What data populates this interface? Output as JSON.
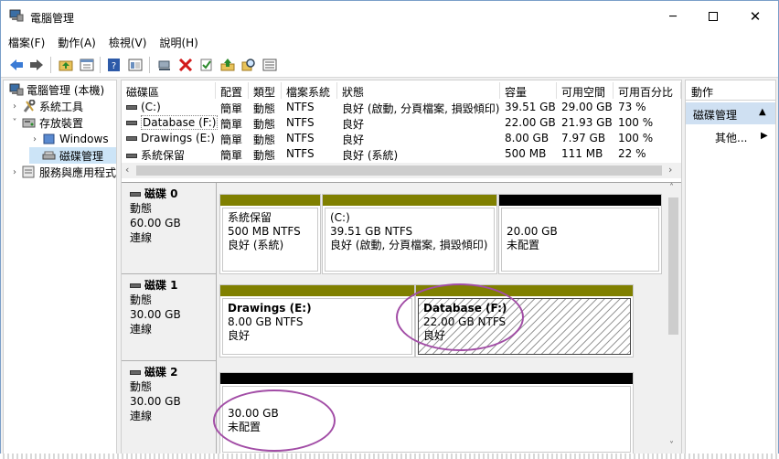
{
  "window": {
    "title": "電腦管理"
  },
  "menu": [
    "檔案(F)",
    "動作(A)",
    "檢視(V)",
    "說明(H)"
  ],
  "toolbar_icons": [
    "back-arrow-icon",
    "forward-arrow-icon",
    "up-folder-icon",
    "properties-icon",
    "help-icon",
    "console-tree-icon",
    "connect-icon",
    "delete-icon",
    "check-icon",
    "export-icon",
    "search-icon",
    "list-icon"
  ],
  "tree": {
    "root": "電腦管理 (本機)",
    "system_tools": "系統工具",
    "storage": "存放裝置",
    "windows": "Windows",
    "disk_mgmt": "磁碟管理",
    "services": "服務與應用程式"
  },
  "volumes": {
    "columns": [
      "磁碟區",
      "配置",
      "類型",
      "檔案系統",
      "狀態",
      "容量",
      "可用空間",
      "可用百分比"
    ],
    "rows": [
      {
        "name": "(C:)",
        "layout": "簡單",
        "type": "動態",
        "fs": "NTFS",
        "status": "良好 (啟動, 分頁檔案, 損毀傾印)",
        "capacity": "39.51 GB",
        "free": "29.00 GB",
        "pct": "73 %"
      },
      {
        "name": "Database (F:)",
        "layout": "簡單",
        "type": "動態",
        "fs": "NTFS",
        "status": "良好",
        "capacity": "22.00 GB",
        "free": "21.93 GB",
        "pct": "100 %"
      },
      {
        "name": "Drawings (E:)",
        "layout": "簡單",
        "type": "動態",
        "fs": "NTFS",
        "status": "良好",
        "capacity": "8.00 GB",
        "free": "7.97 GB",
        "pct": "100 %"
      },
      {
        "name": "系統保留",
        "layout": "簡單",
        "type": "動態",
        "fs": "NTFS",
        "status": "良好 (系統)",
        "capacity": "500 MB",
        "free": "111 MB",
        "pct": "22 %"
      }
    ]
  },
  "disks": [
    {
      "name": "磁碟 0",
      "type": "動態",
      "size": "60.00 GB",
      "state": "連線",
      "partitions": [
        {
          "label": "系統保留",
          "detail": "500 MB NTFS",
          "status": "良好 (系統)",
          "bar": "#808000"
        },
        {
          "label": "(C:)",
          "detail": "39.51 GB NTFS",
          "status": "良好 (啟動, 分頁檔案, 損毀傾印)",
          "bar": "#808000"
        },
        {
          "label": "",
          "detail": "20.00 GB",
          "status": "未配置",
          "bar": "#000000"
        }
      ]
    },
    {
      "name": "磁碟 1",
      "type": "動態",
      "size": "30.00 GB",
      "state": "連線",
      "partitions": [
        {
          "label": "Drawings  (E:)",
          "detail": "8.00 GB NTFS",
          "status": "良好",
          "bar": "#808000"
        },
        {
          "label": "Database  (F:)",
          "detail": "22.00 GB NTFS",
          "status": "良好",
          "bar": "#808000"
        }
      ]
    },
    {
      "name": "磁碟 2",
      "type": "動態",
      "size": "30.00 GB",
      "state": "連線",
      "partitions": [
        {
          "label": "",
          "detail": "30.00 GB",
          "status": "未配置",
          "bar": "#000000"
        }
      ]
    }
  ],
  "actions": {
    "header": "動作",
    "section": "磁碟管理",
    "more": "其他..."
  },
  "colors": {
    "primary_partition": "#808000",
    "unallocated": "#000000",
    "highlight_circle": "#a24da6",
    "selection": "#cfe0f2"
  }
}
